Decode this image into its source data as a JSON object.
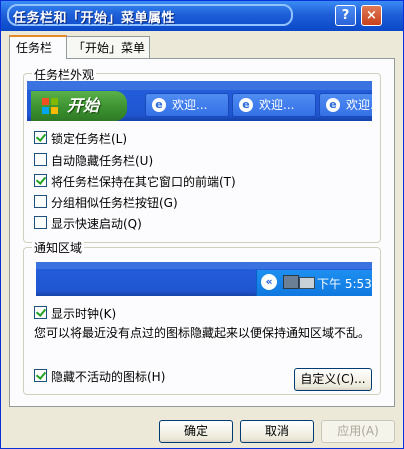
{
  "window": {
    "title": "任务栏和「开始」菜单属性"
  },
  "titlebar": {
    "help_label": "?",
    "close_label": "×"
  },
  "tabs": [
    {
      "label": "任务栏",
      "active": true
    },
    {
      "label": "「开始」菜单",
      "active": false
    }
  ],
  "appearance": {
    "group_label": "任务栏外观",
    "start_label": "开始",
    "task_buttons": [
      "欢迎...",
      "欢迎...",
      "欢迎..."
    ],
    "options": [
      {
        "label": "锁定任务栏(L)",
        "checked": true
      },
      {
        "label": "自动隐藏任务栏(U)",
        "checked": false
      },
      {
        "label": "将任务栏保持在其它窗口的前端(T)",
        "checked": true
      },
      {
        "label": "分组相似任务栏按钮(G)",
        "checked": false
      },
      {
        "label": "显示快速启动(Q)",
        "checked": false
      }
    ]
  },
  "notification": {
    "group_label": "通知区域",
    "clock_text": "下午 5:53",
    "show_clock": {
      "label": "显示时钟(K)",
      "checked": true
    },
    "description": "您可以将最近没有点过的图标隐藏起来以便保持通知区域不乱。",
    "hide_inactive": {
      "label": "隐藏不活动的图标(H)",
      "checked": true
    },
    "customize_label": "自定义(C)..."
  },
  "buttons": {
    "ok": "确定",
    "cancel": "取消",
    "apply": "应用(A)"
  },
  "colors": {
    "accent": "#0a48c8",
    "taskbar": "#245edb",
    "start": "#3a8f2e",
    "check": "#21a121"
  }
}
